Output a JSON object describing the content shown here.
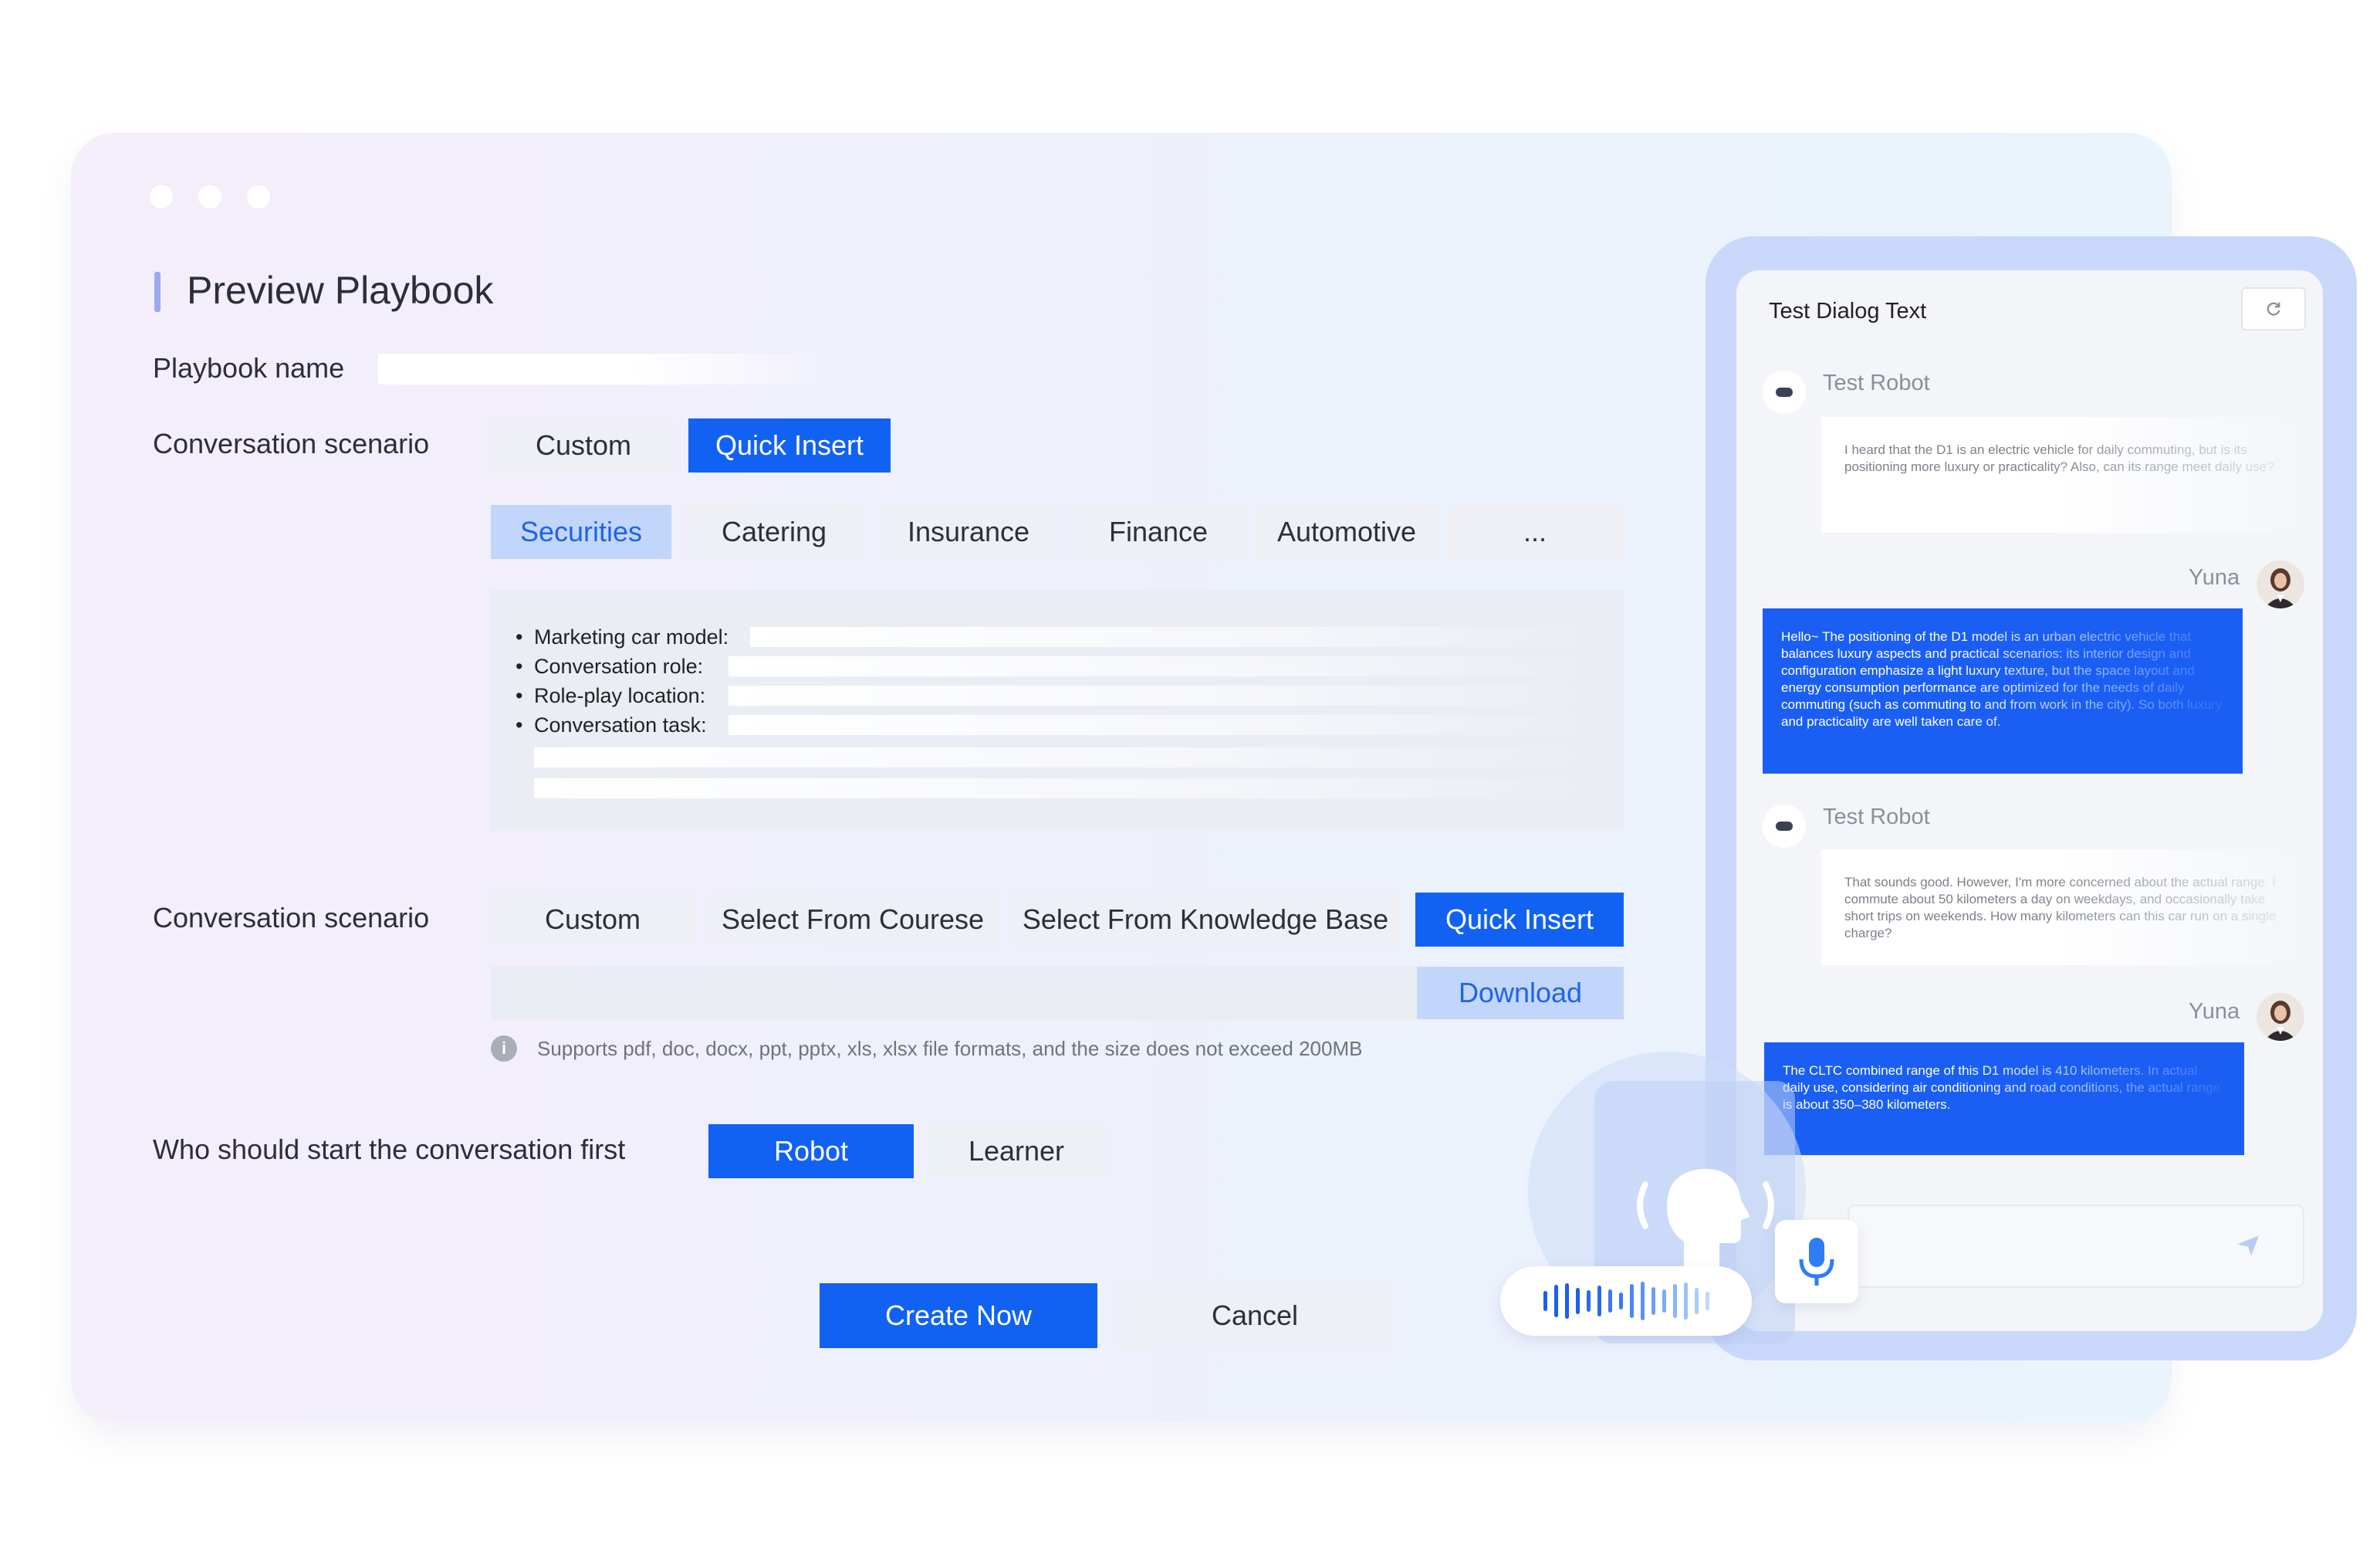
{
  "preview": {
    "title": "Preview Playbook",
    "playbook_name_label": "Playbook name",
    "scenario1": {
      "label": "Conversation scenario",
      "modes": [
        {
          "label": "Custom",
          "selected": false
        },
        {
          "label": "Quick Insert",
          "selected": true
        }
      ],
      "industries": [
        {
          "label": "Securities",
          "selected": true
        },
        {
          "label": "Catering",
          "selected": false
        },
        {
          "label": "Insurance",
          "selected": false
        },
        {
          "label": "Finance",
          "selected": false
        },
        {
          "label": "Automotive",
          "selected": false
        },
        {
          "label": "...",
          "selected": false
        }
      ],
      "fields": [
        "Marketing car model:",
        "Conversation role:",
        "Role-play location:",
        "Conversation task:"
      ]
    },
    "scenario2": {
      "label": "Conversation scenario",
      "modes": [
        {
          "label": "Custom",
          "selected": false
        },
        {
          "label": "Select From Courese",
          "selected": false
        },
        {
          "label": "Select From Knowledge Base",
          "selected": false
        },
        {
          "label": "Quick Insert",
          "selected": true
        }
      ],
      "download_label": "Download",
      "hint": "Supports pdf, doc, docx, ppt, pptx, xls, xlsx file formats, and the size does not exceed 200MB"
    },
    "starter": {
      "label": "Who should start the conversation first",
      "options": [
        {
          "label": "Robot",
          "selected": true
        },
        {
          "label": "Learner",
          "selected": false
        }
      ]
    },
    "actions": {
      "create_label": "Create Now",
      "cancel_label": "Cancel"
    }
  },
  "chat": {
    "title": "Test Dialog Text",
    "bot_name": "Test Robot",
    "user_name": "Yuna",
    "messages": [
      {
        "from": "bot",
        "text": "I heard that the D1 is an electric vehicle for daily commuting, but is its positioning more luxury or practicality? Also, can its range meet daily use?"
      },
      {
        "from": "user",
        "text": "Hello~ The positioning of the D1 model is an urban electric vehicle that balances luxury aspects and practical scenarios: its interior design and configuration emphasize a light luxury texture, but the space layout and energy consumption performance are optimized for the needs of daily commuting (such as commuting to and from work in the city). So both luxury and practicality are well taken care of."
      },
      {
        "from": "bot",
        "text": "That sounds good. However, I'm more concerned about the actual range. I commute about 50 kilometers a day on weekdays, and occasionally take short trips on weekends. How many kilometers can this car run on a single charge?"
      },
      {
        "from": "user",
        "text": "The CLTC combined range of this D1 model is 410 kilometers. In actual daily use, considering air conditioning and road conditions, the actual range is about 350–380 kilometers."
      }
    ]
  },
  "colors": {
    "primary": "#1162f2",
    "primary_light": "#c2d6fb",
    "chat_frame": "#c9d8fa",
    "accent_bar": "#9aaaf0"
  },
  "icons": [
    "info-icon",
    "refresh-icon",
    "robot-avatar-icon",
    "user-avatar-icon",
    "microphone-icon",
    "send-icon",
    "head-voice-icon",
    "sound-wave-icon"
  ]
}
